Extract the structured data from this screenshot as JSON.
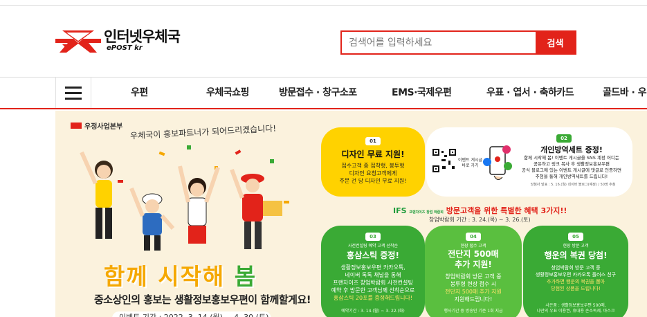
{
  "header": {
    "logo_ko": "인터넷우체국",
    "logo_en": "ePOST kr",
    "search_placeholder": "검색어를 입력하세요",
    "search_button": "검색"
  },
  "nav": {
    "items": [
      "우편",
      "우체국쇼핑",
      "방문접수 · 창구소포",
      "EMS·국제우편",
      "우표 · 엽서 · 축하카드",
      "골드바 · 우"
    ]
  },
  "banner": {
    "brand": "우정사업본부",
    "handwriting": "우체국이 홍보파트너가 되어드리겠습니다!",
    "headline_1": "함께 시작해",
    "headline_2": "봄",
    "subline": "중소상인의 홍보는 생활정보홍보우편이 함께할게요!",
    "period": "이벤트 기간 : 2022. 3. 14.(월) ~ 4. 30.(토)",
    "ifs_title": "IFS",
    "ifs_small": "프랜차이즈 창업 박람회",
    "ifs_headline": "방문고객을 위한 특별한 혜택 3가지!!",
    "ifs_period": "창업박람회 기간 : 3. 24.(목) ~ 3. 26.(토)",
    "cards": [
      {
        "num": "01",
        "title": "디자인 무료 지원!",
        "body": [
          "접수고객 중 접착형, 봉투형",
          "디자인 요청고객에게",
          "주문 건 당 디자인 무료 지원!"
        ]
      },
      {
        "num": "02",
        "title": "개인방역세트 증정!",
        "body": [
          "함께 시작해 봄! 이벤트 게시글을 SNS 계정 어디든",
          "공유하고 링크 복사 후 생활정보홍보우편",
          "공식 블로그에 있는 이벤트 게시글에 댓글로 인증하면",
          "추첨을 통해 개인방역세트를 드립니다!"
        ],
        "qr_caption": "이벤트 게시글\n바로 가기",
        "note": "당첨자 발표 : 5. 16.(월) 네이버 블로그(예정) / 50명 추첨"
      },
      {
        "num": "03",
        "pre": "사전컨설팅 예약 고객 선착순",
        "title": "홍삼스틱 증정!",
        "body": [
          "생활정보홍보우편 카카오톡,",
          "네이버 톡톡 채널을 통해",
          "프랜차이즈 창업박람회 사전컨설팅",
          "예약 후 방문한 고객님께 선착순으로",
          "홍삼스틱 20포를 증정해드립니다!"
        ],
        "foot": "예약기간 : 3. 14.(월) ~ 3. 22.(화)"
      },
      {
        "num": "04",
        "pre": "현장 접수 고객",
        "title": "전단지 500매",
        "title2": "추가 지원!",
        "body": [
          "창업박람회 방문 고객 중",
          "봉투형 현장 접수 시",
          "전단지 500매 추가 지원",
          "지원해드립니다!"
        ],
        "foot": "행사기간 중 방송인 기준 1회 지급"
      },
      {
        "num": "05",
        "pre": "현장 방문 고객",
        "title": "행운의 복권 당첨!",
        "body": [
          "창업박람회 방문 고객 중",
          "생활정보홍보우편 카카오톡 플러스 친구",
          "추가하면 행운의 복권을 뽑아",
          "당첨된 상품을 드립니다!"
        ],
        "foot": "사은품 : 생활정보홍보우편 500매,",
        "foot2": "나만의 우표 이용권, 휴대용 손소독제, 마스크"
      }
    ]
  },
  "colors": {
    "brand_red": "#e2231a",
    "banner_bg": "#fbf2dd",
    "yellow": "#ffd200",
    "green": "#3aaa35"
  }
}
